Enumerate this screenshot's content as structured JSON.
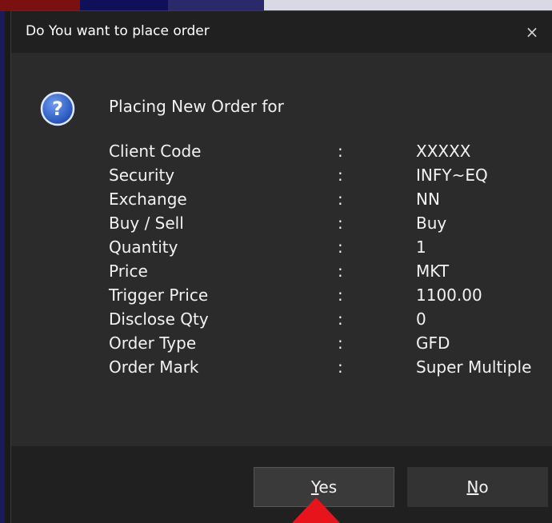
{
  "dialog": {
    "title": "Do You want to place order",
    "close_glyph": "×",
    "icon": "question-icon",
    "heading": "Placing New Order for",
    "separator": ":",
    "rows": [
      {
        "label": "Client Code",
        "value": "XXXXX"
      },
      {
        "label": "Security",
        "value": "INFY~EQ"
      },
      {
        "label": "Exchange",
        "value": "NN"
      },
      {
        "label": "Buy / Sell",
        "value": "Buy"
      },
      {
        "label": "Quantity",
        "value": "1"
      },
      {
        "label": "Price",
        "value": "MKT"
      },
      {
        "label": "Trigger Price",
        "value": "1100.00"
      },
      {
        "label": "Disclose Qty",
        "value": "0"
      },
      {
        "label": "Order Type",
        "value": "GFD"
      },
      {
        "label": "Order Mark",
        "value": "Super Multiple"
      }
    ],
    "buttons": {
      "yes_mnemonic": "Y",
      "yes_rest": "es",
      "no_mnemonic": "N",
      "no_rest": "o"
    }
  },
  "colors": {
    "dialog_bg": "#2b2b2b",
    "titlebar_bg": "#202020",
    "text": "#f2f2f2",
    "annotation_arrow": "#e8141b"
  }
}
